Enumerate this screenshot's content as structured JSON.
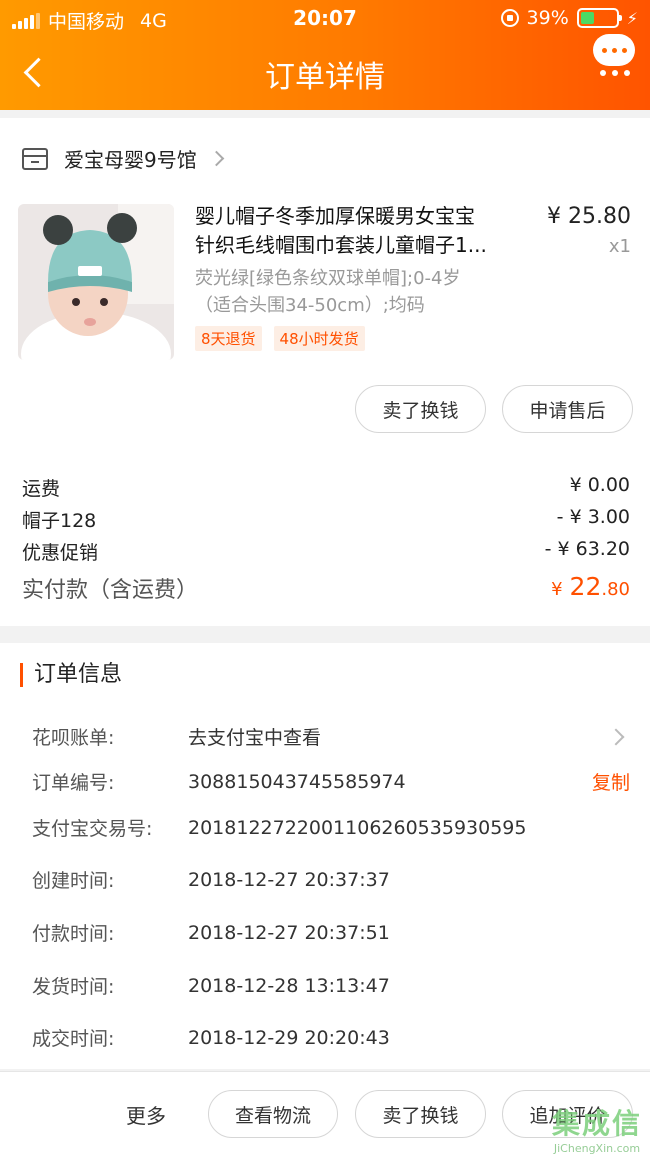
{
  "status_bar": {
    "carrier": "中国移动",
    "network": "4G",
    "time": "20:07",
    "battery": "39%",
    "battery_level": 0.39
  },
  "nav": {
    "title": "订单详情",
    "back_icon": "chevron-left-icon",
    "more_icon": "message-more-icon"
  },
  "shop": {
    "name": "爱宝母婴9号馆"
  },
  "product": {
    "name_line1": "婴儿帽子冬季加厚保暖男女宝宝",
    "name_line2": "针织毛线帽围巾套装儿童帽子1...",
    "price": "¥ 25.80",
    "quantity": "x1",
    "spec_line1": "荧光绿[绿色条纹双球单帽];0-4岁",
    "spec_line2": "（适合头围34-50cm）;均码",
    "tags": [
      "8天退货",
      "48小时发货"
    ]
  },
  "item_actions": {
    "sell": "卖了换钱",
    "after_sale": "申请售后"
  },
  "fees": [
    {
      "label": "运费",
      "amount": "¥ 0.00"
    },
    {
      "label": "帽子128",
      "amount": "- ¥ 3.00"
    },
    {
      "label": "优惠促销",
      "amount": "- ¥ 63.20"
    }
  ],
  "total": {
    "label": "实付款（含运费）",
    "currency": "¥",
    "integer": "22",
    "decimal": ".80"
  },
  "order_info": {
    "title": "订单信息",
    "rows": [
      {
        "label": "花呗账单:",
        "value": "去支付宝中查看"
      },
      {
        "label": "订单编号:",
        "value": "308815043745585974",
        "action": "复制"
      },
      {
        "label": "支付宝交易号:",
        "value": "2018122722001106260535930595"
      },
      {
        "label": "创建时间:",
        "value": "2018-12-27 20:37:37"
      },
      {
        "label": "付款时间:",
        "value": "2018-12-27 20:37:51"
      },
      {
        "label": "发货时间:",
        "value": "2018-12-28 13:13:47"
      },
      {
        "label": "成交时间:",
        "value": "2018-12-29 20:20:43"
      }
    ]
  },
  "bottom_bar": {
    "more": "更多",
    "track": "查看物流",
    "sell": "卖了换钱",
    "review": "追加评价"
  },
  "watermark": {
    "text": "集成信",
    "sub": "JiChengXin.com"
  },
  "colors": {
    "accent": "#ff5000",
    "header_start": "#ff9a00",
    "header_end": "#ff5400"
  }
}
